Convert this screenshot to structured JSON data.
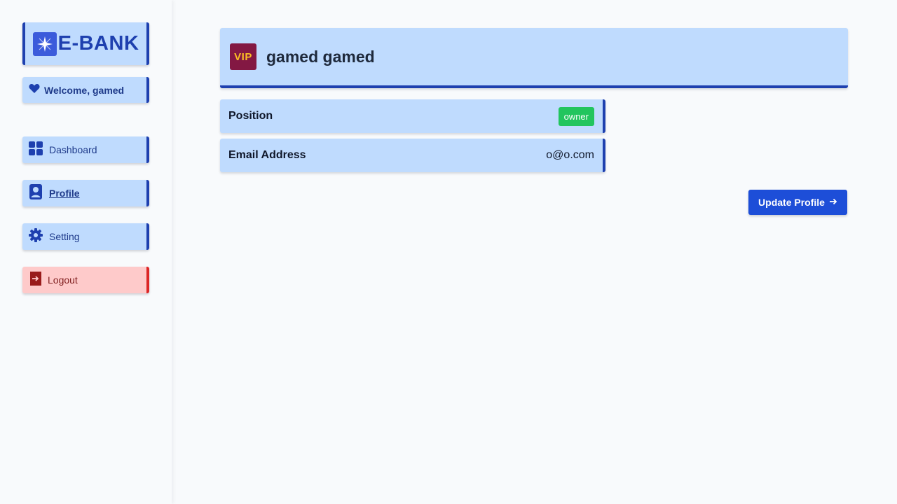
{
  "app": {
    "logo_text": "E-BANK",
    "logo_icon": "sparkle-icon"
  },
  "sidebar": {
    "welcome": "Welcome, gamed",
    "welcome_icon": "heart-icon",
    "items": [
      {
        "label": "Dashboard",
        "icon": "grid-icon",
        "active": false
      },
      {
        "label": "Profile",
        "icon": "user-badge-icon",
        "active": true
      },
      {
        "label": "Setting",
        "icon": "gear-icon",
        "active": false
      }
    ],
    "logout": {
      "label": "Logout",
      "icon": "logout-icon"
    }
  },
  "profile": {
    "badge": "VIP",
    "name": "gamed gamed",
    "rows": [
      {
        "label": "Position",
        "value": "owner"
      },
      {
        "label": "Email Address",
        "value": "o@o.com"
      }
    ],
    "update_button": "Update Profile"
  },
  "colors": {
    "accent": "#1e40af",
    "card_bg": "#bfdbfe",
    "button": "#1d4ed8",
    "badge_green": "#22c55e",
    "logout_bg": "#fecaca",
    "logout_accent": "#dc2626",
    "vip_bg": "#831843",
    "vip_text": "#fbbf24"
  }
}
